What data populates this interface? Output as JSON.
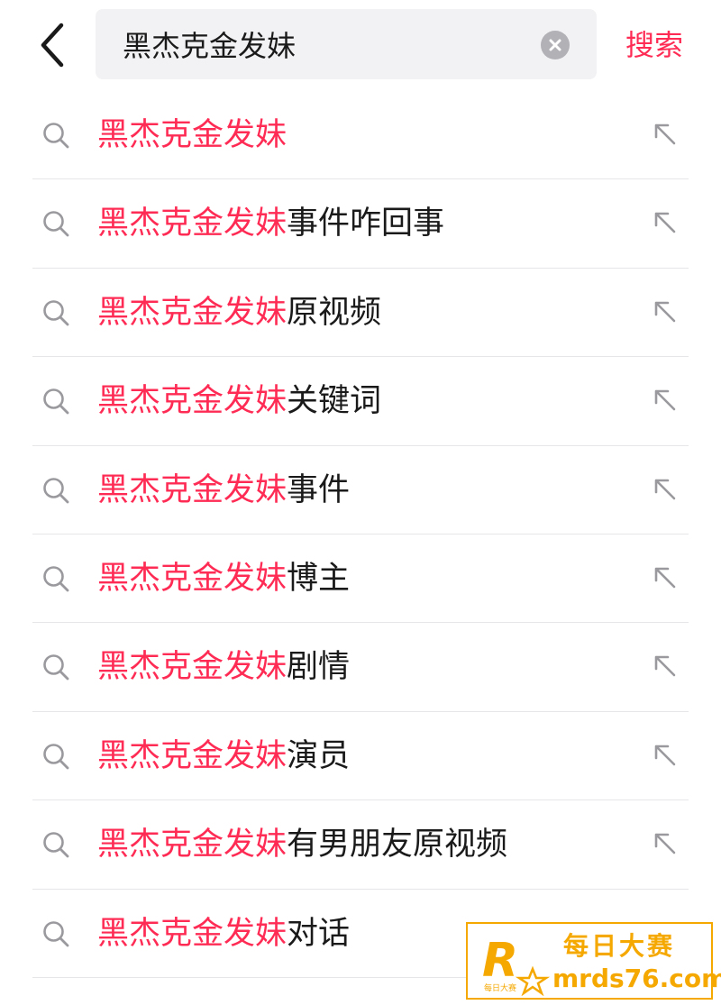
{
  "search": {
    "query": "黑杰克金发妹",
    "submit_label": "搜索"
  },
  "suggestions": [
    {
      "match": "黑杰克金发妹",
      "rest": ""
    },
    {
      "match": "黑杰克金发妹",
      "rest": "事件咋回事"
    },
    {
      "match": "黑杰克金发妹",
      "rest": "原视频"
    },
    {
      "match": "黑杰克金发妹",
      "rest": "关键词"
    },
    {
      "match": "黑杰克金发妹",
      "rest": "事件"
    },
    {
      "match": "黑杰克金发妹",
      "rest": "博主"
    },
    {
      "match": "黑杰克金发妹",
      "rest": "剧情"
    },
    {
      "match": "黑杰克金发妹",
      "rest": "演员"
    },
    {
      "match": "黑杰克金发妹",
      "rest": "有男朋友原视频"
    },
    {
      "match": "黑杰克金发妹",
      "rest": "对话"
    }
  ],
  "watermark": {
    "logo_letter": "R",
    "logo_small": "每日大赛",
    "title": "每日大赛",
    "site": "mrds76.com"
  },
  "colors": {
    "accent": "#fe2c55",
    "watermark": "#f5a800"
  },
  "icons": {
    "back": "chevron-left-icon",
    "clear": "clear-circle-icon",
    "suggestion": "search-icon",
    "fill": "arrow-up-left-icon"
  }
}
